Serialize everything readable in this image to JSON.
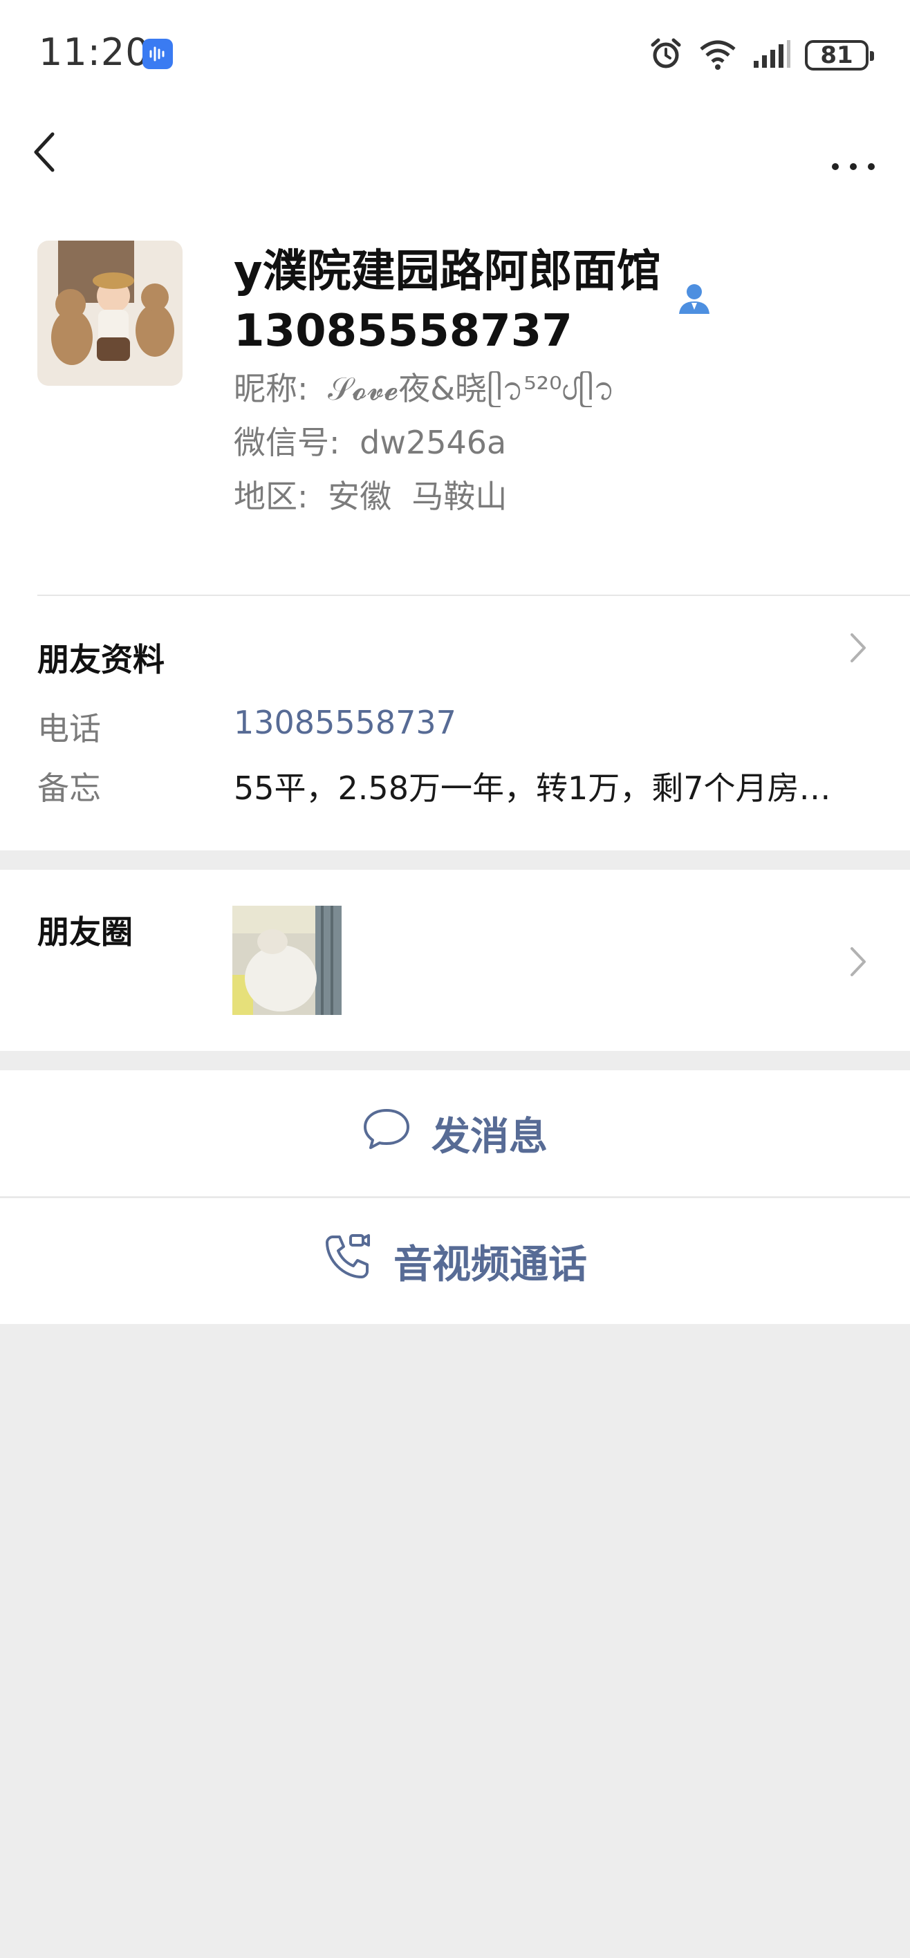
{
  "status_bar": {
    "time": "11:20",
    "battery": "81"
  },
  "profile": {
    "name": "y濮院建园路阿郎面馆13085558737",
    "nickname_label": "昵称:",
    "nickname": "𝒮𝓸𝓿𝓮夜&晓ᥫ᭡⁵²⁰ᦔᥫ᭡",
    "wechat_id_label": "微信号:",
    "wechat_id": "dw2546a",
    "region_label": "地区:",
    "region": "安徽  马鞍山"
  },
  "friend_info": {
    "title": "朋友资料",
    "phone_label": "电话",
    "phone": "13085558737",
    "note_label": "备忘",
    "note": "55平，2.58万一年，转1万，剩7个月房…"
  },
  "moments": {
    "title": "朋友圈"
  },
  "actions": {
    "message": "发消息",
    "call": "音视频通话"
  },
  "colors": {
    "link": "#576b95",
    "background": "#ededed",
    "avatar_badge": "#4d8fe0"
  }
}
